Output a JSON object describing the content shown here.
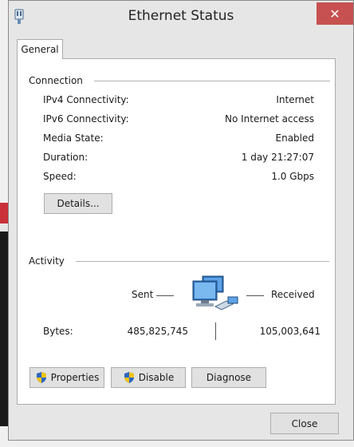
{
  "window": {
    "title": "Ethernet Status",
    "close_glyph": "✕"
  },
  "tabs": [
    {
      "label": "General"
    }
  ],
  "connection": {
    "header": "Connection",
    "rows": [
      {
        "label": "IPv4 Connectivity:",
        "value": "Internet"
      },
      {
        "label": "IPv6 Connectivity:",
        "value": "No Internet access"
      },
      {
        "label": "Media State:",
        "value": "Enabled"
      },
      {
        "label": "Duration:",
        "value": "1 day 21:27:07"
      },
      {
        "label": "Speed:",
        "value": "1.0 Gbps"
      }
    ],
    "details_button": "Details..."
  },
  "activity": {
    "header": "Activity",
    "sent_label": "Sent",
    "received_label": "Received",
    "bytes_label": "Bytes:",
    "bytes_sent": "485,825,745",
    "bytes_received": "105,003,641",
    "network_icon": "network-computers-icon"
  },
  "buttons": {
    "properties": "Properties",
    "disable": "Disable",
    "diagnose": "Diagnose",
    "close": "Close"
  },
  "colors": {
    "close_button": "#c75050",
    "window_bg": "#e6e6e6",
    "panel_bg": "#ffffff"
  }
}
